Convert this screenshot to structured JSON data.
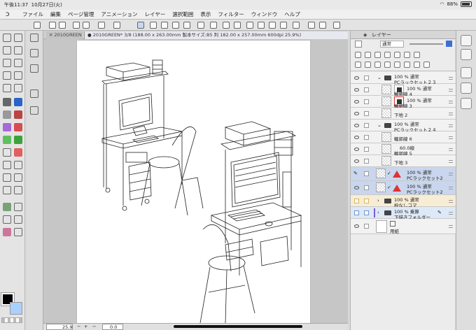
{
  "status_bar": {
    "time": "午後11:37",
    "date": "10月27日(火)",
    "battery": "88%"
  },
  "menu": {
    "items": [
      "ファイル",
      "編集",
      "ページ管理",
      "アニメーション",
      "レイヤー",
      "選択範囲",
      "表示",
      "フィルター",
      "ウィンドウ",
      "ヘルプ"
    ]
  },
  "tabs": {
    "inactive_label": "2010GREEN",
    "active_label": "2010GREEN* 3/8 (188.00 x 263.00mm 製本サイズ:B5 判 182.00 x 257.00mm 600dpi 25.9%)"
  },
  "canvas": {
    "zoom": "25.9",
    "rotation": "0.0"
  },
  "layer_panel": {
    "title": "レイヤー",
    "blend_mode": "通常",
    "layers": [
      {
        "line1": "100 % 通常",
        "line2": "PCラックセット２３",
        "type": "folder",
        "selected": false
      },
      {
        "line1": "100 % 通常",
        "line2": "輪郭線 4",
        "type": "raster",
        "selected": false
      },
      {
        "line1": "100 % 通常",
        "line2": "輪郭線 3",
        "type": "raster",
        "selected": false
      },
      {
        "line1": "",
        "line2": "下地 2",
        "type": "raster",
        "selected": false
      },
      {
        "line1": "100 % 通常",
        "line2": "PCラックセット２４",
        "type": "folder",
        "selected": false
      },
      {
        "line1": "",
        "line2": "輪郭線 6",
        "type": "raster",
        "selected": false
      },
      {
        "line1": "60.0線",
        "line2": "輪郭線 5",
        "type": "raster",
        "selected": false
      },
      {
        "line1": "",
        "line2": "下地 3",
        "type": "raster",
        "selected": false
      },
      {
        "line1": "100 % 通常",
        "line2": "PCラックセット2",
        "type": "3d",
        "selected": true
      },
      {
        "line1": "100 % 通常",
        "line2": "PCラックセット2",
        "type": "3d",
        "selected": true
      },
      {
        "line1": "100 % 通常",
        "line2": "枠なしコマ",
        "type": "folder",
        "selected": false
      },
      {
        "line1": "100 % 乗算",
        "line2": "下描きフォルダー",
        "type": "folder",
        "selected": false
      },
      {
        "line1": "",
        "line2": "用紙",
        "type": "paper",
        "selected": false
      }
    ]
  },
  "colors": {
    "accent": "#3b6fd6",
    "selected_layer": "#c9d6ee",
    "bg_color": "#a9d1ff"
  }
}
